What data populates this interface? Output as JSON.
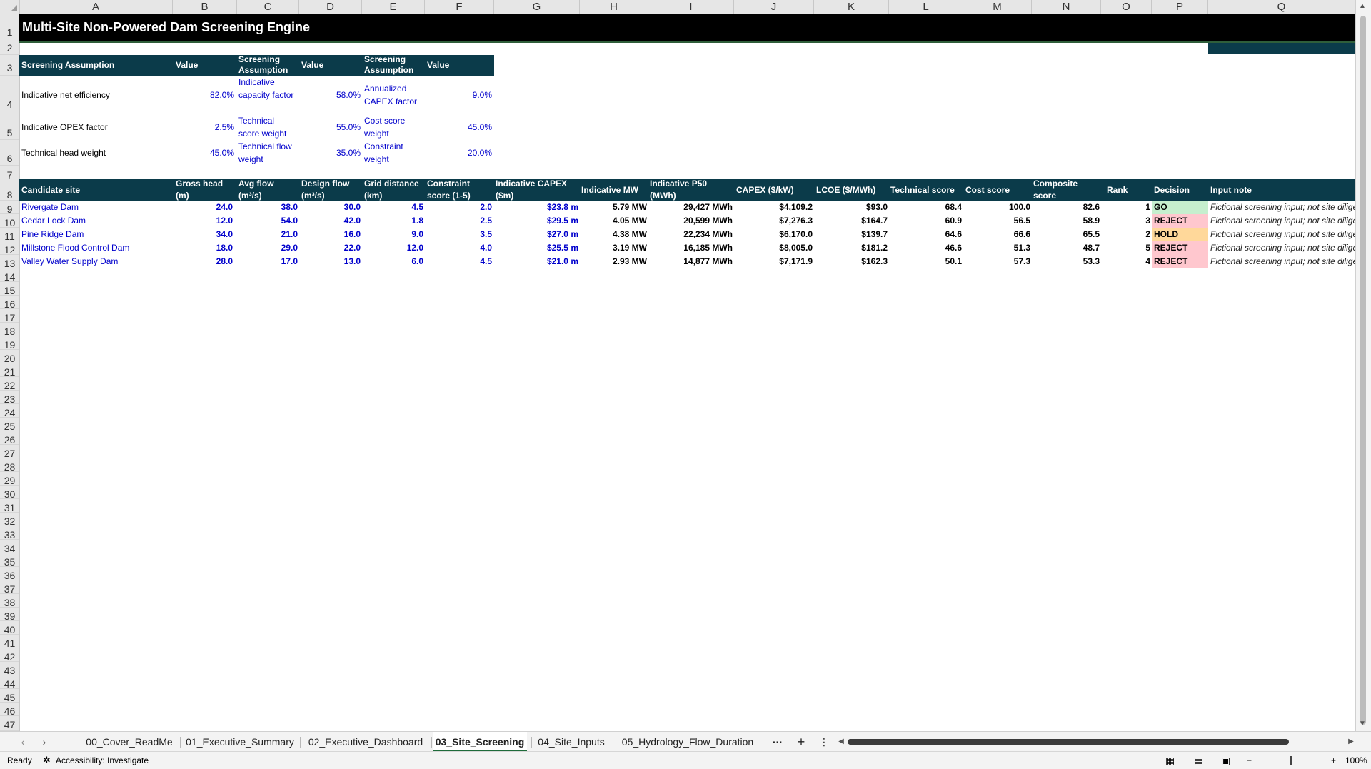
{
  "columns": [
    "A",
    "B",
    "C",
    "D",
    "E",
    "F",
    "G",
    "H",
    "I",
    "J",
    "K",
    "L",
    "M",
    "N",
    "O",
    "P",
    "Q"
  ],
  "rows": [
    "1",
    "2",
    "3",
    "4",
    "5",
    "6",
    "7",
    "8",
    "9",
    "10",
    "11",
    "12",
    "13",
    "14",
    "15",
    "16",
    "17",
    "18",
    "19",
    "20",
    "21",
    "22",
    "23",
    "24",
    "25",
    "26",
    "27",
    "28",
    "29",
    "30",
    "31",
    "32",
    "33",
    "34",
    "35",
    "36",
    "37",
    "38",
    "39",
    "40",
    "41",
    "42",
    "43",
    "44",
    "45",
    "46",
    "47"
  ],
  "title": "Multi-Site Non-Powered Dam Screening Engine",
  "assumptions": {
    "headers": [
      "Screening Assumption",
      "Value",
      "Screening Assumption",
      "Value",
      "Screening Assumption",
      "Value"
    ],
    "rows": [
      {
        "l1": "Indicative net efficiency",
        "v1": "82.0%",
        "l2": "Indicative capacity factor",
        "v2": "58.0%",
        "l3": "Annualized CAPEX factor",
        "v3": "9.0%"
      },
      {
        "l1": "Indicative OPEX factor",
        "v1": "2.5%",
        "l2": "Technical score weight",
        "v2": "55.0%",
        "l3": "Cost score weight",
        "v3": "45.0%"
      },
      {
        "l1": "Technical head weight",
        "v1": "45.0%",
        "l2": "Technical flow weight",
        "v2": "35.0%",
        "l3": "Constraint weight",
        "v3": "20.0%"
      }
    ]
  },
  "table": {
    "headers": {
      "site": "Candidate site",
      "head": "Gross head (m)",
      "flow": "Avg flow (m³/s)",
      "design": "Design flow (m³/s)",
      "grid": "Grid distance (km)",
      "constraint": "Constraint score (1-5)",
      "capex_m": "Indicative CAPEX ($m)",
      "mw": "Indicative MW",
      "p50": "Indicative P50 (MWh)",
      "capex_kw": "CAPEX ($/kW)",
      "lcoe": "LCOE ($/MWh)",
      "tech": "Technical score",
      "cost": "Cost score",
      "comp": "Composite score",
      "rank": "Rank",
      "decision": "Decision",
      "note": "Input note"
    },
    "rows": [
      {
        "site": "Rivergate Dam",
        "head": "24.0",
        "flow": "38.0",
        "design": "30.0",
        "grid": "4.5",
        "constraint": "2.0",
        "capex_m": "$23.8 m",
        "mw": "5.79 MW",
        "p50": "29,427 MWh",
        "capex_kw": "$4,109.2",
        "lcoe": "$93.0",
        "tech": "68.4",
        "cost": "100.0",
        "comp": "82.6",
        "rank": "1",
        "decision": "GO",
        "decision_color": "#c6efce",
        "note": "Fictional screening input; not site diligence"
      },
      {
        "site": "Cedar Lock Dam",
        "head": "12.0",
        "flow": "54.0",
        "design": "42.0",
        "grid": "1.8",
        "constraint": "2.5",
        "capex_m": "$29.5 m",
        "mw": "4.05 MW",
        "p50": "20,599 MWh",
        "capex_kw": "$7,276.3",
        "lcoe": "$164.7",
        "tech": "60.9",
        "cost": "56.5",
        "comp": "58.9",
        "rank": "3",
        "decision": "REJECT",
        "decision_color": "#ffc7ce",
        "note": "Fictional screening input; not site diligence"
      },
      {
        "site": "Pine Ridge Dam",
        "head": "34.0",
        "flow": "21.0",
        "design": "16.0",
        "grid": "9.0",
        "constraint": "3.5",
        "capex_m": "$27.0 m",
        "mw": "4.38 MW",
        "p50": "22,234 MWh",
        "capex_kw": "$6,170.0",
        "lcoe": "$139.7",
        "tech": "64.6",
        "cost": "66.6",
        "comp": "65.5",
        "rank": "2",
        "decision": "HOLD",
        "decision_color": "#ffd89a",
        "note": "Fictional screening input; not site diligence"
      },
      {
        "site": "Millstone Flood Control Dam",
        "head": "18.0",
        "flow": "29.0",
        "design": "22.0",
        "grid": "12.0",
        "constraint": "4.0",
        "capex_m": "$25.5 m",
        "mw": "3.19 MW",
        "p50": "16,185 MWh",
        "capex_kw": "$8,005.0",
        "lcoe": "$181.2",
        "tech": "46.6",
        "cost": "51.3",
        "comp": "48.7",
        "rank": "5",
        "decision": "REJECT",
        "decision_color": "#ffc7ce",
        "note": "Fictional screening input; not site diligence"
      },
      {
        "site": "Valley Water Supply Dam",
        "head": "28.0",
        "flow": "17.0",
        "design": "13.0",
        "grid": "6.0",
        "constraint": "4.5",
        "capex_m": "$21.0 m",
        "mw": "2.93 MW",
        "p50": "14,877 MWh",
        "capex_kw": "$7,171.9",
        "lcoe": "$162.3",
        "tech": "50.1",
        "cost": "57.3",
        "comp": "53.3",
        "rank": "4",
        "decision": "REJECT",
        "decision_color": "#ffc7ce",
        "note": "Fictional screening input; not site diligence"
      }
    ]
  },
  "tabs": [
    "00_Cover_ReadMe",
    "01_Executive_Summary",
    "02_Executive_Dashboard",
    "03_Site_Screening",
    "04_Site_Inputs",
    "05_Hydrology_Flow_Duration"
  ],
  "active_tab": "03_Site_Screening",
  "tab_more": "···",
  "tab_add": "+",
  "tab_menu": "⋮",
  "status": {
    "ready": "Ready",
    "accessibility": "Accessibility: Investigate",
    "zoom": "100%"
  }
}
